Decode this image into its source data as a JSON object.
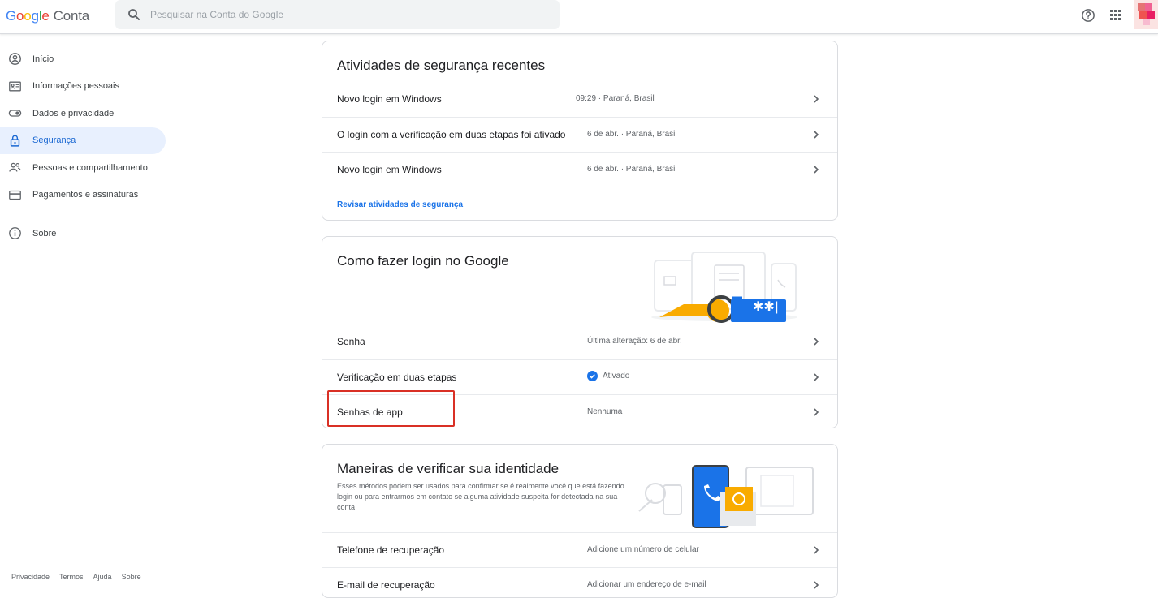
{
  "header": {
    "logo_letters": [
      "G",
      "o",
      "o",
      "g",
      "l",
      "e"
    ],
    "product": "Conta",
    "search_placeholder": "Pesquisar na Conta do Google"
  },
  "sidebar": {
    "items": [
      {
        "label": "Início",
        "icon": "home-icon",
        "active": false
      },
      {
        "label": "Informações pessoais",
        "icon": "id-card-icon",
        "active": false
      },
      {
        "label": "Dados e privacidade",
        "icon": "toggle-icon",
        "active": false
      },
      {
        "label": "Segurança",
        "icon": "lock-icon",
        "active": true
      },
      {
        "label": "Pessoas e compartilhamento",
        "icon": "people-icon",
        "active": false
      },
      {
        "label": "Pagamentos e assinaturas",
        "icon": "card-icon",
        "active": false
      }
    ],
    "about": "Sobre"
  },
  "footer": [
    "Privacidade",
    "Termos",
    "Ajuda",
    "Sobre"
  ],
  "security_activity": {
    "title": "Atividades de segurança recentes",
    "rows": [
      {
        "label": "Novo login em Windows",
        "value": "09:29 · Paraná, Brasil"
      },
      {
        "label": "O login com a verificação em duas etapas foi ativado",
        "value": "6 de abr. · Paraná, Brasil"
      },
      {
        "label": "Novo login em Windows",
        "value": "6 de abr. · Paraná, Brasil"
      }
    ],
    "link": "Revisar atividades de segurança"
  },
  "signin": {
    "title": "Como fazer login no Google",
    "rows": [
      {
        "label": "Senha",
        "value": "Última alteração: 6 de abr."
      },
      {
        "label": "Verificação em duas etapas",
        "value": "Ativado"
      },
      {
        "label": "Senhas de app",
        "value": "Nenhuma"
      }
    ],
    "password_mask": "✱✱|"
  },
  "identity": {
    "title": "Maneiras de verificar sua identidade",
    "description": "Esses métodos podem ser usados para confirmar se é realmente você que está fazendo login ou para entrarmos em contato se alguma atividade suspeita for detectada na sua conta",
    "rows": [
      {
        "label": "Telefone de recuperação",
        "value": "Adicione um número de celular"
      },
      {
        "label": "E-mail de recuperação",
        "value": "Adicionar um endereço de e-mail"
      }
    ]
  },
  "colors": {
    "accent": "#1a73e8",
    "active_bg": "#e8f0fe",
    "highlight": "#d93025",
    "key": "#f9ab00",
    "card_blue": "#1a73e8"
  }
}
